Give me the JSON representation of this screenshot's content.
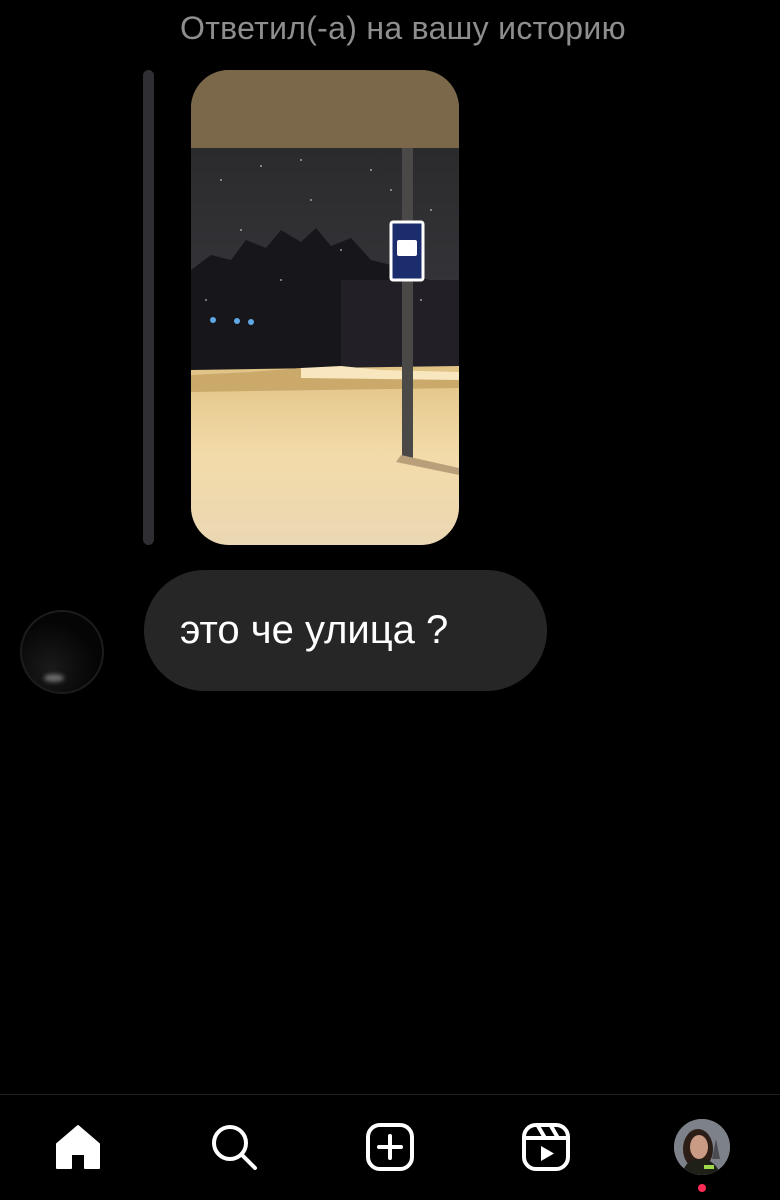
{
  "thread": {
    "reply_label": "Ответил(-а) на вашу историю",
    "message_text": "это че улица ?"
  },
  "icons": {
    "home": "home-icon",
    "search": "search-icon",
    "create": "create-post-icon",
    "reels": "reels-icon",
    "profile": "profile-avatar"
  },
  "colors": {
    "background": "#000000",
    "bubble": "#262626",
    "secondary_text": "#8e8e8e",
    "notification_dot": "#ff2d55"
  }
}
